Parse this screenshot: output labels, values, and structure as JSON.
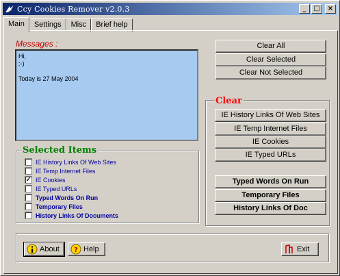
{
  "window": {
    "title": "Ccy Cookies Remover v2.0.3",
    "buttons": [
      "_",
      "□",
      "×"
    ]
  },
  "tabs": [
    {
      "label": "Main",
      "active": true
    },
    {
      "label": "Settings"
    },
    {
      "label": "Misc"
    },
    {
      "label": "Brief help"
    }
  ],
  "messages": {
    "label": "Messages :",
    "lines": [
      "Hi,",
      ":-)",
      "",
      "Today is 27 May 2004"
    ]
  },
  "actions": {
    "clear_all": "Clear All",
    "clear_selected": "Clear Selected",
    "clear_not_selected": "Clear Not Selected"
  },
  "clear": {
    "title": "Clear",
    "buttons": [
      "IE History Links Of Web Sites",
      "IE Temp Internet Files",
      "IE Cookies",
      "IE Typed URLs"
    ],
    "bold_buttons": [
      "Typed Words On Run",
      "Temporary Files",
      "History Links Of Doc"
    ]
  },
  "selected_items": {
    "title": "Selected Items",
    "items": [
      {
        "label": "IE History Links Of Web Sites",
        "checked": false,
        "bold": false
      },
      {
        "label": "IE Temp Internet Files",
        "checked": false,
        "bold": false
      },
      {
        "label": "IE Cookies",
        "checked": true,
        "bold": false
      },
      {
        "label": "IE Typed URLs",
        "checked": false,
        "bold": false
      },
      {
        "label": "Typed Words On Run",
        "checked": false,
        "bold": true
      },
      {
        "label": "Temporary Files",
        "checked": false,
        "bold": true
      },
      {
        "label": "History Links Of Documents",
        "checked": false,
        "bold": true
      }
    ]
  },
  "bottom": {
    "about": "About",
    "help": "Help",
    "exit": "Exit"
  },
  "icons": {
    "about": "info-icon",
    "help": "question-icon",
    "exit": "exit-door-icon",
    "app": "app-icon"
  },
  "colors": {
    "title_start": "#0a246a",
    "title_end": "#a6caf0",
    "message_bg": "#a6caf0",
    "clear_title": "#ff0000",
    "selected_title": "#008000",
    "messages_label": "#c00000",
    "item_text": "#0000a0"
  }
}
